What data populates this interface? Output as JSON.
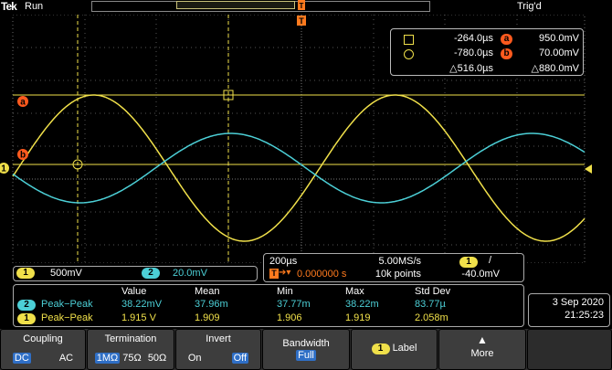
{
  "topbar": {
    "brand": "Tek",
    "run_state": "Run",
    "trigger_state": "Trig'd",
    "trigger_marker": "T"
  },
  "colors": {
    "ch1": "#f0e04a",
    "ch2": "#4ccfd6",
    "cursor_marker": "#ff5a1e",
    "grid": "#555555"
  },
  "markers": {
    "ref_a": "a",
    "ref_b": "b",
    "ch1_ground": "1",
    "trigger_level": "T"
  },
  "cursors": {
    "t1": "-264.0µs",
    "t2": "-780.0µs",
    "dt": "△516.0µs",
    "va_label": "a",
    "va": "950.0mV",
    "vb_label": "b",
    "vb": "70.00mV",
    "dv": "△880.0mV"
  },
  "channels": {
    "ch1_label": "1",
    "ch1_scale": "500mV",
    "ch2_label": "2",
    "ch2_scale": "20.0mV"
  },
  "horizontal": {
    "scale": "200µs",
    "sample_rate": "5.00MS/s",
    "trigger_pos": "0.000000 s",
    "record_length": "10k points",
    "trigger_source": "1",
    "trigger_slope": "/",
    "trigger_level": "-40.0mV"
  },
  "measurements": {
    "headers": [
      "Value",
      "Mean",
      "Min",
      "Max",
      "Std Dev"
    ],
    "rows": [
      {
        "ch": "2",
        "name": "Peak−Peak",
        "value": "38.22mV",
        "mean": "37.96m",
        "min": "37.77m",
        "max": "38.22m",
        "std": "83.77µ"
      },
      {
        "ch": "1",
        "name": "Peak−Peak",
        "value": "1.915 V",
        "mean": "1.909",
        "min": "1.906",
        "max": "1.919",
        "std": "2.058m"
      }
    ]
  },
  "datetime": {
    "date": "3 Sep 2020",
    "time": "21:25:23"
  },
  "menu": {
    "coupling": {
      "title": "Coupling",
      "opt1": "DC",
      "opt2": "AC"
    },
    "termination": {
      "title": "Termination",
      "opt1": "1MΩ",
      "opt2": "75Ω",
      "opt3": "50Ω"
    },
    "invert": {
      "title": "Invert",
      "opt1": "On",
      "opt2": "Off"
    },
    "bandwidth": {
      "title": "Bandwidth",
      "value": "Full"
    },
    "label": {
      "badge": "1",
      "text": "Label"
    },
    "more": {
      "text": "More",
      "arrow": "▲"
    }
  }
}
